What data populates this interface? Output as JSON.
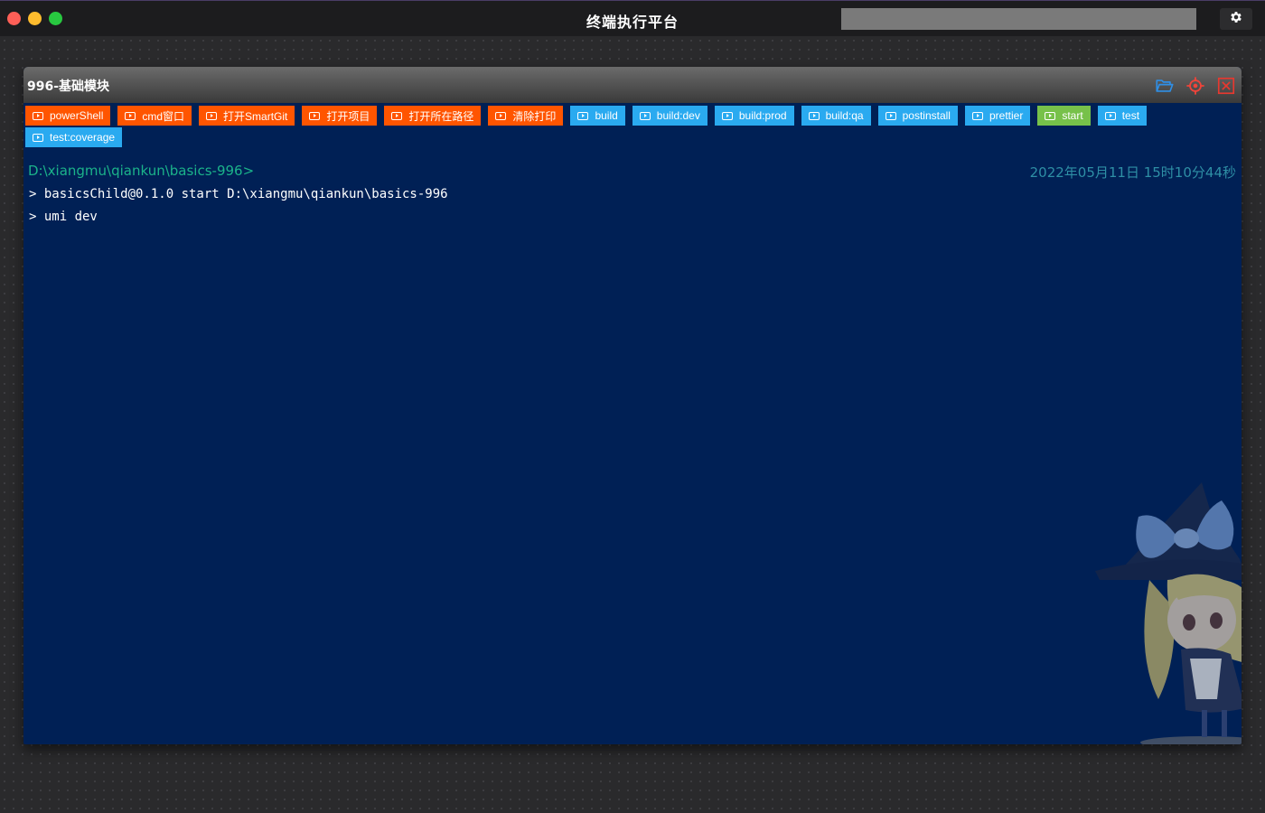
{
  "window": {
    "title": "终端执行平台",
    "search": {
      "value": "",
      "placeholder": ""
    },
    "settings_icon": "gear-icon"
  },
  "panel": {
    "title": "996-基础模块",
    "header_icons": [
      "folder-open-icon",
      "locate-icon",
      "close-box-icon"
    ],
    "buttons": [
      {
        "label": "powerShell",
        "color": "#ff5500"
      },
      {
        "label": "cmd窗口",
        "color": "#ff5500"
      },
      {
        "label": "打开SmartGit",
        "color": "#ff5500"
      },
      {
        "label": "打开项目",
        "color": "#ff5500"
      },
      {
        "label": "打开所在路径",
        "color": "#ff5500"
      },
      {
        "label": "清除打印",
        "color": "#ff5500"
      },
      {
        "label": "build",
        "color": "#2aaaf0"
      },
      {
        "label": "build:dev",
        "color": "#2aaaf0"
      },
      {
        "label": "build:prod",
        "color": "#2aaaf0"
      },
      {
        "label": "build:qa",
        "color": "#2aaaf0"
      },
      {
        "label": "postinstall",
        "color": "#2aaaf0"
      },
      {
        "label": "prettier",
        "color": "#2aaaf0"
      },
      {
        "label": "start",
        "color": "#77c14a"
      },
      {
        "label": "test",
        "color": "#2aaaf0"
      },
      {
        "label": "test:coverage",
        "color": "#2aaaf0"
      }
    ],
    "terminal": {
      "prompt": "D:\\xiangmu\\qiankun\\basics-996>",
      "timestamp": "2022年05月11日 15时10分44秒",
      "lines": [
        "> basicsChild@0.1.0 start D:\\xiangmu\\qiankun\\basics-996",
        "> umi dev"
      ]
    },
    "colors": {
      "background": "#002055",
      "prompt": "#1bb38a",
      "timestamp": "#2e8fa5"
    }
  }
}
